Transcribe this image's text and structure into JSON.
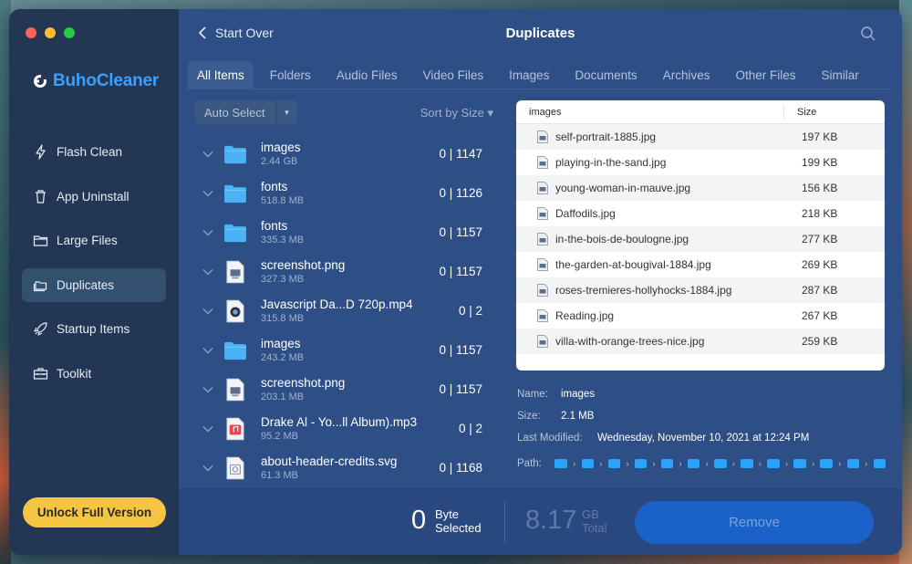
{
  "sidebar": {
    "brand": "BuhoCleaner",
    "items": [
      {
        "label": "Flash Clean",
        "icon": "bolt-icon"
      },
      {
        "label": "App Uninstall",
        "icon": "trash-icon"
      },
      {
        "label": "Large Files",
        "icon": "folder-icon"
      },
      {
        "label": "Duplicates",
        "icon": "duplicate-folder-icon",
        "active": true
      },
      {
        "label": "Startup Items",
        "icon": "rocket-icon"
      },
      {
        "label": "Toolkit",
        "icon": "toolbox-icon"
      }
    ],
    "unlock_label": "Unlock Full Version"
  },
  "header": {
    "back_label": "Start Over",
    "title": "Duplicates"
  },
  "tabs": [
    "All Items",
    "Folders",
    "Audio Files",
    "Video Files",
    "Images",
    "Documents",
    "Archives",
    "Other Files",
    "Similar"
  ],
  "toolbar": {
    "auto_select": "Auto Select",
    "sort": "Sort by Size ▾"
  },
  "groups": [
    {
      "name": "images",
      "size": "2.44 GB",
      "count": "0 | 1147",
      "type": "folder"
    },
    {
      "name": "fonts",
      "size": "518.8 MB",
      "count": "0 | 1126",
      "type": "folder"
    },
    {
      "name": "fonts",
      "size": "335.3 MB",
      "count": "0 | 1157",
      "type": "folder"
    },
    {
      "name": "screenshot.png",
      "size": "327.3 MB",
      "count": "0 | 1157",
      "type": "image"
    },
    {
      "name": "Javascript Da...D 720p.mp4",
      "size": "315.8 MB",
      "count": "0 | 2",
      "type": "video"
    },
    {
      "name": "images",
      "size": "243.2 MB",
      "count": "0 | 1157",
      "type": "folder"
    },
    {
      "name": "screenshot.png",
      "size": "203.1 MB",
      "count": "0 | 1157",
      "type": "image"
    },
    {
      "name": "Drake Al - Yo...ll Album).mp3",
      "size": "95.2 MB",
      "count": "0 | 2",
      "type": "audio"
    },
    {
      "name": "about-header-credits.svg",
      "size": "61.3 MB",
      "count": "0 | 1168",
      "type": "svg"
    }
  ],
  "detail": {
    "col_name": "images",
    "col_size": "Size",
    "files": [
      {
        "name": "self-portrait-1885.jpg",
        "size": "197 KB"
      },
      {
        "name": "playing-in-the-sand.jpg",
        "size": "199 KB"
      },
      {
        "name": "young-woman-in-mauve.jpg",
        "size": "156 KB"
      },
      {
        "name": "Daffodils.jpg",
        "size": "218 KB"
      },
      {
        "name": "in-the-bois-de-boulogne.jpg",
        "size": "277 KB"
      },
      {
        "name": "the-garden-at-bougival-1884.jpg",
        "size": "269 KB"
      },
      {
        "name": "roses-tremieres-hollyhocks-1884.jpg",
        "size": "287 KB"
      },
      {
        "name": "Reading.jpg",
        "size": "267 KB"
      },
      {
        "name": "villa-with-orange-trees-nice.jpg",
        "size": "259 KB"
      }
    ]
  },
  "meta": {
    "name_label": "Name:",
    "name_value": "images",
    "size_label": "Size:",
    "size_value": "2.1 MB",
    "modified_label": "Last Modified:",
    "modified_value": "Wednesday, November 10, 2021 at 12:24 PM",
    "path_label": "Path:",
    "path_segments": 13
  },
  "footer": {
    "selected_value": "0",
    "selected_unit": "Byte",
    "selected_label": "Selected",
    "total_value": "8.17",
    "total_unit": "GB",
    "total_label": "Total",
    "remove_label": "Remove"
  },
  "colors": {
    "accent": "#3aa0ff",
    "unlock": "#f5c542",
    "remove": "#1a62c7",
    "folder": "#4bb3f5"
  }
}
